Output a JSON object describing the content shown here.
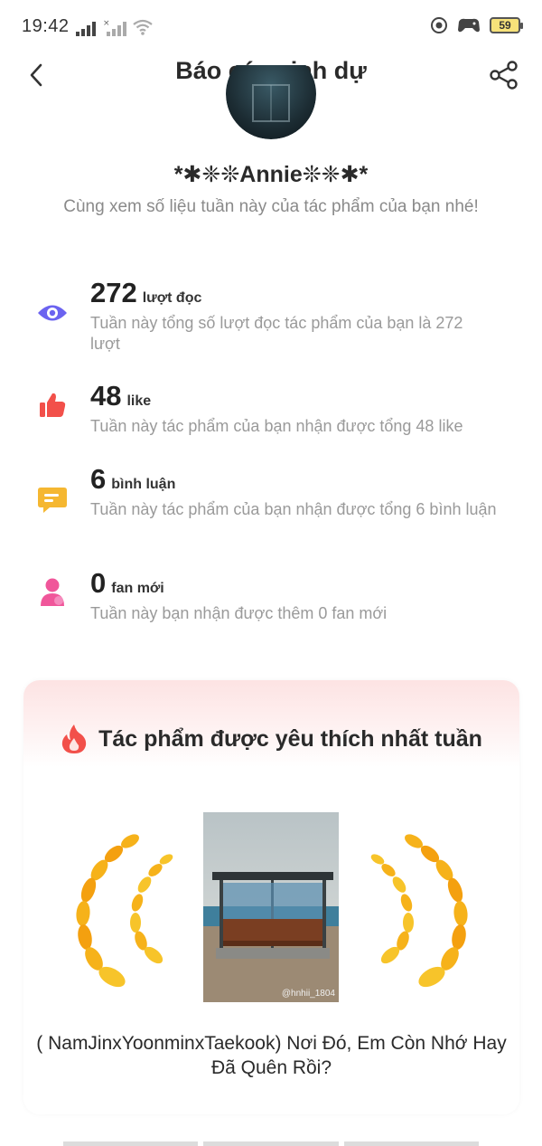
{
  "status_bar": {
    "time": "19:42",
    "battery": "59"
  },
  "nav": {
    "title": "Báo cáo vinh dự"
  },
  "profile": {
    "username": "*✱❈❊Annie❊❈✱*",
    "subtitle": "Cùng xem số liệu tuần này của tác phẩm của bạn nhé!"
  },
  "stats": [
    {
      "icon": "eye-icon",
      "number": "272",
      "unit": "lượt đọc",
      "description": "Tuần này tổng số lượt đọc tác phẩm của bạn là 272 lượt",
      "color": "#6b63f0"
    },
    {
      "icon": "thumbs-up-icon",
      "number": "48",
      "unit": "like",
      "description": "Tuần này tác phẩm của bạn nhận được tổng 48 like",
      "color": "#f2504a"
    },
    {
      "icon": "comment-icon",
      "number": "6",
      "unit": "bình luận",
      "description": "Tuần này tác phẩm của bạn nhận được tổng 6 bình luận",
      "color": "#f5b731"
    },
    {
      "icon": "person-icon",
      "number": "0",
      "unit": "fan mới",
      "description": "Tuần này bạn nhận được thêm 0 fan mới",
      "color": "#f0569a"
    }
  ],
  "favorite": {
    "heading": "Tác phẩm được yêu thích nhất tuần",
    "book_title": "( NamJinxYoonminxTaekook) Nơi Đó, Em Còn Nhớ Hay Đã Quên Rồi?",
    "cover_watermark": "@hnhii_1804"
  }
}
